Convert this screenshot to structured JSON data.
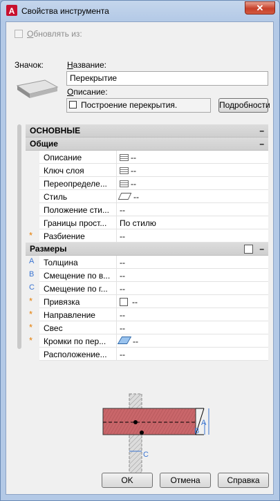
{
  "window": {
    "title": "Свойства инструмента",
    "close_label": "✕"
  },
  "update_from": {
    "label": "Обновлять из:"
  },
  "icon_label": "Значок:",
  "name": {
    "label": "Название:",
    "value": "Перекрытие"
  },
  "description": {
    "label": "Описание:",
    "value": "Построение перекрытия.",
    "details_button": "Подробности"
  },
  "palette": {
    "main_header": "ОСНОВНЫЕ",
    "general_header": "Общие",
    "general_rows": [
      {
        "label": "Описание",
        "value": "--",
        "icon": "list-icon"
      },
      {
        "label": "Ключ слоя",
        "value": "--",
        "icon": "list-icon"
      },
      {
        "label": "Переопределе...",
        "value": "--",
        "icon": "list-icon"
      },
      {
        "label": "Стиль",
        "value": "--",
        "icon": "slab-style-icon"
      },
      {
        "label": "Положение сти...",
        "value": "--"
      },
      {
        "label": "Границы прост...",
        "value": "По стилю"
      },
      {
        "label": "Разбиение",
        "value": "--",
        "mark": "*"
      }
    ],
    "dimensions_header": "Размеры",
    "dimension_rows": [
      {
        "label": "Толщина",
        "value": "--",
        "mark": "A"
      },
      {
        "label": "Смещение по в...",
        "value": "--",
        "mark": "B"
      },
      {
        "label": "Смещение по г...",
        "value": "--",
        "mark": "C"
      },
      {
        "label": "Привязка",
        "value": "--",
        "mark": "*",
        "icon": "checkbox-icon"
      },
      {
        "label": "Направление",
        "value": "--",
        "mark": "*"
      },
      {
        "label": "Свес",
        "value": "--",
        "mark": "*"
      },
      {
        "label": "Кромки по пер...",
        "value": "--",
        "mark": "*",
        "icon": "edge-icon"
      },
      {
        "label": "Расположение...",
        "value": "--"
      }
    ],
    "diagram_labels": {
      "a": "A",
      "b": "B",
      "c": "C"
    }
  },
  "buttons": {
    "ok": "OK",
    "cancel": "Отмена",
    "help": "Справка"
  },
  "colors": {
    "star": "#e57c00",
    "letter": "#3a74d1",
    "slab": "#c9666a"
  }
}
